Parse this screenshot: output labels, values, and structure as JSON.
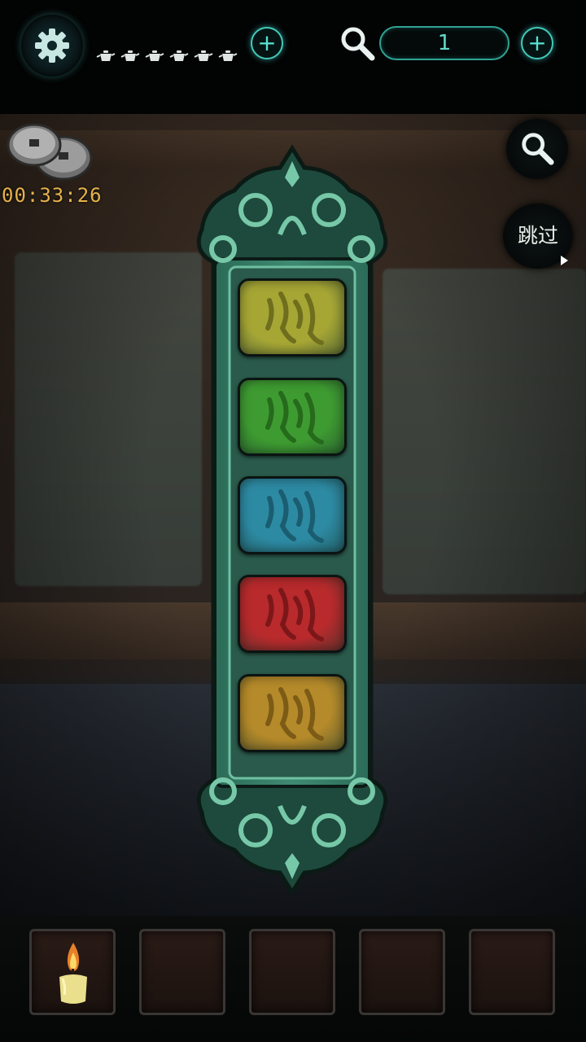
{
  "hud": {
    "teapot_lives": 6,
    "hint_count": "1"
  },
  "timer": {
    "elapsed": "00:33:26"
  },
  "skip_button": {
    "label": "跳过"
  },
  "puzzle": {
    "tiles": [
      {
        "name": "tile-yellow-green",
        "color": "#a6a635",
        "glyph_color": "#6f6e1e"
      },
      {
        "name": "tile-green",
        "color": "#3e9b31",
        "glyph_color": "#266a1c"
      },
      {
        "name": "tile-blue",
        "color": "#2d8aa3",
        "glyph_color": "#1b5d70"
      },
      {
        "name": "tile-red",
        "color": "#b82a2c",
        "glyph_color": "#7c1719"
      },
      {
        "name": "tile-amber",
        "color": "#b58a2a",
        "glyph_color": "#7c5b16"
      }
    ]
  },
  "inventory": {
    "slots": [
      {
        "item": "candle-icon"
      },
      {
        "item": ""
      },
      {
        "item": ""
      },
      {
        "item": ""
      },
      {
        "item": ""
      }
    ]
  },
  "colors": {
    "accent": "#42c9b9",
    "timer": "#e5b24b"
  }
}
